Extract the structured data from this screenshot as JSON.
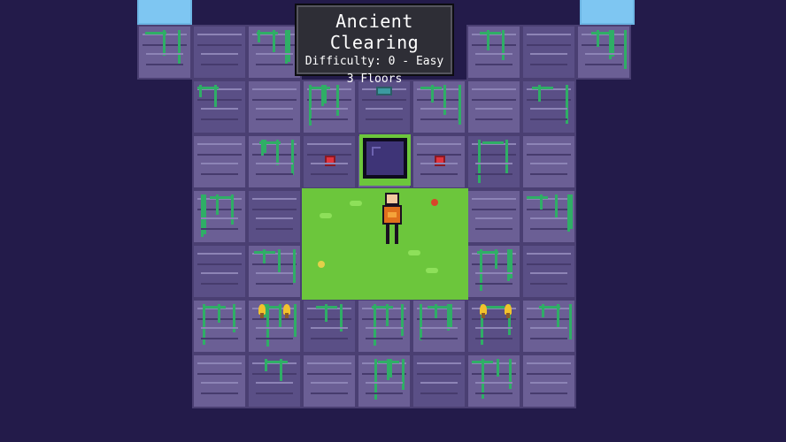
{
  "level_info": {
    "title": "Ancient Clearing",
    "difficulty": "Difficulty: 0 - Easy",
    "floors": "3 Floors"
  },
  "colors": {
    "background": "#231b4a",
    "stone": "#6b5f95",
    "grass": "#6cc63c",
    "vine": "#2fae66",
    "gem": "#e2343e",
    "sky": "#7ec6f2"
  }
}
